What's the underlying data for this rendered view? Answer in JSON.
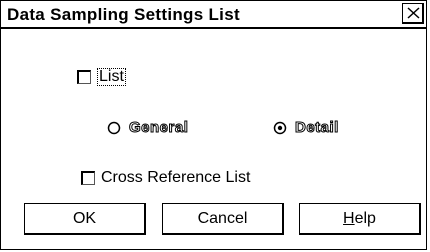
{
  "window": {
    "title": "Data Sampling Settings List",
    "close_glyph": "X"
  },
  "options": {
    "list_checkbox": {
      "label": "List",
      "checked": false
    },
    "list_mode": {
      "options": [
        "General",
        "Detail"
      ],
      "selected": "Detail"
    },
    "cross_reference_checkbox": {
      "label": "Cross Reference List",
      "checked": false
    }
  },
  "buttons": {
    "ok_label": "OK",
    "cancel_label": "Cancel",
    "help_label_mnemonic": "H",
    "help_label_rest": "elp"
  },
  "icons": {
    "close": "close-icon",
    "radio_unselected": "radio-unselected-icon",
    "radio_selected": "radio-selected-icon"
  }
}
